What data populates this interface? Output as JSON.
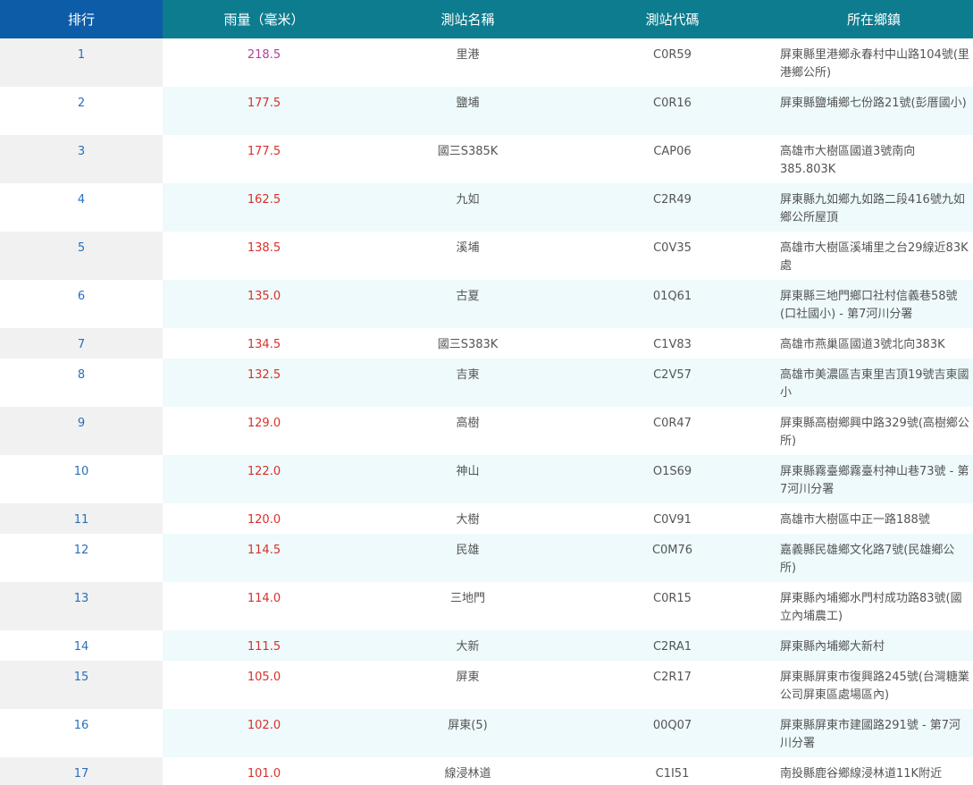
{
  "headers": {
    "rank": "排行",
    "rain": "雨量（毫米）",
    "name": "測站名稱",
    "code": "測站代碼",
    "location": "所在鄉鎮"
  },
  "colors": {
    "header_rank_bg": "#0d5ca8",
    "header_bg": "#0d7c8f",
    "rain_red": "#d9302b",
    "rain_purple": "#b0409a",
    "rank_text": "#2a6ebb",
    "row_alt_bg": "#eefafb"
  },
  "rows": [
    {
      "rank": "1",
      "rain": "218.5",
      "name": "里港",
      "code": "C0R59",
      "location": "屏東縣里港鄉永春村中山路104號(里港鄉公所)",
      "color": "purple",
      "lines": 2
    },
    {
      "rank": "2",
      "rain": "177.5",
      "name": "鹽埔",
      "code": "C0R16",
      "location": "屏東縣鹽埔鄉七份路21號(彭厝國小)",
      "color": "red",
      "lines": 2
    },
    {
      "rank": "3",
      "rain": "177.5",
      "name": "國三S385K",
      "code": "CAP06",
      "location": "高雄市大樹區國道3號南向385.803K",
      "color": "red",
      "lines": 2
    },
    {
      "rank": "4",
      "rain": "162.5",
      "name": "九如",
      "code": "C2R49",
      "location": "屏東縣九如鄉九如路二段416號九如鄉公所屋頂",
      "color": "red",
      "lines": 2
    },
    {
      "rank": "5",
      "rain": "138.5",
      "name": "溪埔",
      "code": "C0V35",
      "location": "高雄市大樹區溪埔里之台29線近83K處",
      "color": "red",
      "lines": 2
    },
    {
      "rank": "6",
      "rain": "135.0",
      "name": "古夏",
      "code": "01Q61",
      "location": "屏東縣三地門鄉口社村信義巷58號(口社國小) - 第7河川分署",
      "color": "red",
      "lines": 2
    },
    {
      "rank": "7",
      "rain": "134.5",
      "name": "國三S383K",
      "code": "C1V83",
      "location": "高雄市燕巢區國道3號北向383K",
      "color": "red",
      "lines": 1
    },
    {
      "rank": "8",
      "rain": "132.5",
      "name": "吉東",
      "code": "C2V57",
      "location": "高雄市美濃區吉東里吉頂19號吉東國小",
      "color": "red",
      "lines": 2
    },
    {
      "rank": "9",
      "rain": "129.0",
      "name": "高樹",
      "code": "C0R47",
      "location": "屏東縣高樹鄉興中路329號(高樹鄉公所)",
      "color": "red",
      "lines": 2
    },
    {
      "rank": "10",
      "rain": "122.0",
      "name": "神山",
      "code": "O1S69",
      "location": "屏東縣霧臺鄉霧臺村神山巷73號 - 第7河川分署",
      "color": "red",
      "lines": 2
    },
    {
      "rank": "11",
      "rain": "120.0",
      "name": "大樹",
      "code": "C0V91",
      "location": "高雄市大樹區中正一路188號",
      "color": "red",
      "lines": 1
    },
    {
      "rank": "12",
      "rain": "114.5",
      "name": "民雄",
      "code": "C0M76",
      "location": "嘉義縣民雄鄉文化路7號(民雄鄉公所)",
      "color": "red",
      "lines": 2
    },
    {
      "rank": "13",
      "rain": "114.0",
      "name": "三地門",
      "code": "C0R15",
      "location": "屏東縣內埔鄉水門村成功路83號(國立內埔農工)",
      "color": "red",
      "lines": 2
    },
    {
      "rank": "14",
      "rain": "111.5",
      "name": "大新",
      "code": "C2RA1",
      "location": "屏東縣內埔鄉大新村",
      "color": "red",
      "lines": 1
    },
    {
      "rank": "15",
      "rain": "105.0",
      "name": "屏東",
      "code": "C2R17",
      "location": "屏東縣屏東市復興路245號(台灣糖業公司屏東區處場區內)",
      "color": "red",
      "lines": 2
    },
    {
      "rank": "16",
      "rain": "102.0",
      "name": "屏東(5)",
      "code": "00Q07",
      "location": "屏東縣屏東市建國路291號 - 第7河川分署",
      "color": "red",
      "lines": 2
    },
    {
      "rank": "17",
      "rain": "101.0",
      "name": "線浸林道",
      "code": "C1I51",
      "location": "南投縣鹿谷鄉線浸林道11K附近",
      "color": "red",
      "lines": 1
    }
  ]
}
